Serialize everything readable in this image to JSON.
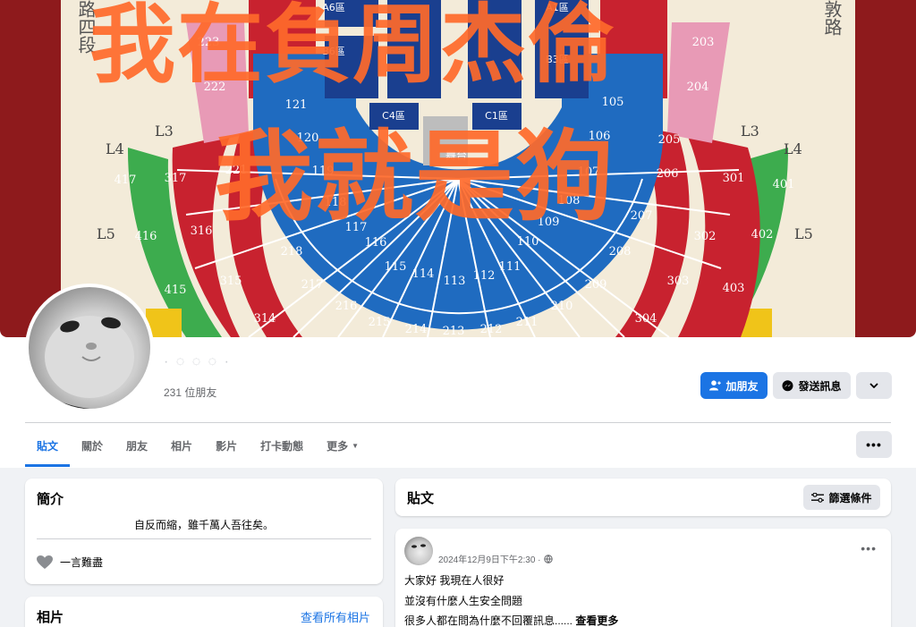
{
  "cover": {
    "overlay_line1": "我在負周杰倫",
    "overlay_line2": "我就是狗",
    "side_left": "路四段",
    "side_right": "敦路",
    "stage_label": "舞台",
    "level_labels": {
      "l3": "L3",
      "l4": "L4",
      "l5": "L5"
    },
    "sections": {
      "red_left": [
        "317",
        "316",
        "315",
        "314",
        "218",
        "217",
        "216",
        "215",
        "214",
        "213"
      ],
      "red_right": [
        "301",
        "302",
        "303",
        "304",
        "206",
        "207",
        "208",
        "209",
        "210",
        "211",
        "212"
      ],
      "blue": [
        "121",
        "120",
        "119",
        "118",
        "117",
        "116",
        "115",
        "114",
        "113",
        "112",
        "111",
        "110",
        "109",
        "108",
        "107",
        "106",
        "105"
      ],
      "pink": [
        "223",
        "222",
        "221",
        "203",
        "204",
        "205"
      ],
      "green": [
        "417",
        "416",
        "415",
        "401",
        "402",
        "403"
      ],
      "floor": [
        "A6區",
        "B6區",
        "C4區",
        "A1區",
        "B3區",
        "C1區"
      ]
    }
  },
  "profile": {
    "name": "· ◌ ◌ ◌ ·",
    "friends": "231 位朋友",
    "add_friend": "加朋友",
    "message": "發送訊息"
  },
  "tabs": [
    {
      "label": "貼文",
      "active": true
    },
    {
      "label": "關於"
    },
    {
      "label": "朋友"
    },
    {
      "label": "相片"
    },
    {
      "label": "影片"
    },
    {
      "label": "打卡動態"
    },
    {
      "label": "更多"
    }
  ],
  "intro": {
    "title": "簡介",
    "bio": "自反而縮，雖千萬人吾往矣。",
    "relationship": "一言難盡"
  },
  "photos": {
    "title": "相片",
    "see_all": "查看所有相片"
  },
  "posts": {
    "title": "貼文",
    "filter": "篩選條件"
  },
  "post": {
    "time": "2024年12月9日下午2:30 ·",
    "lines": [
      "大家好 我現在人很好",
      "並沒有什麼人生安全問題",
      "很多人都在問為什麼不回覆訊息......"
    ],
    "see_more": "查看更多"
  },
  "colors": {
    "accent": "#1b74e4",
    "overlay": "#ff6a2b",
    "seat_red": "#c8222f",
    "seat_blue": "#1f6bc0",
    "seat_pink": "#e89ab6",
    "seat_green": "#3dac4e"
  }
}
